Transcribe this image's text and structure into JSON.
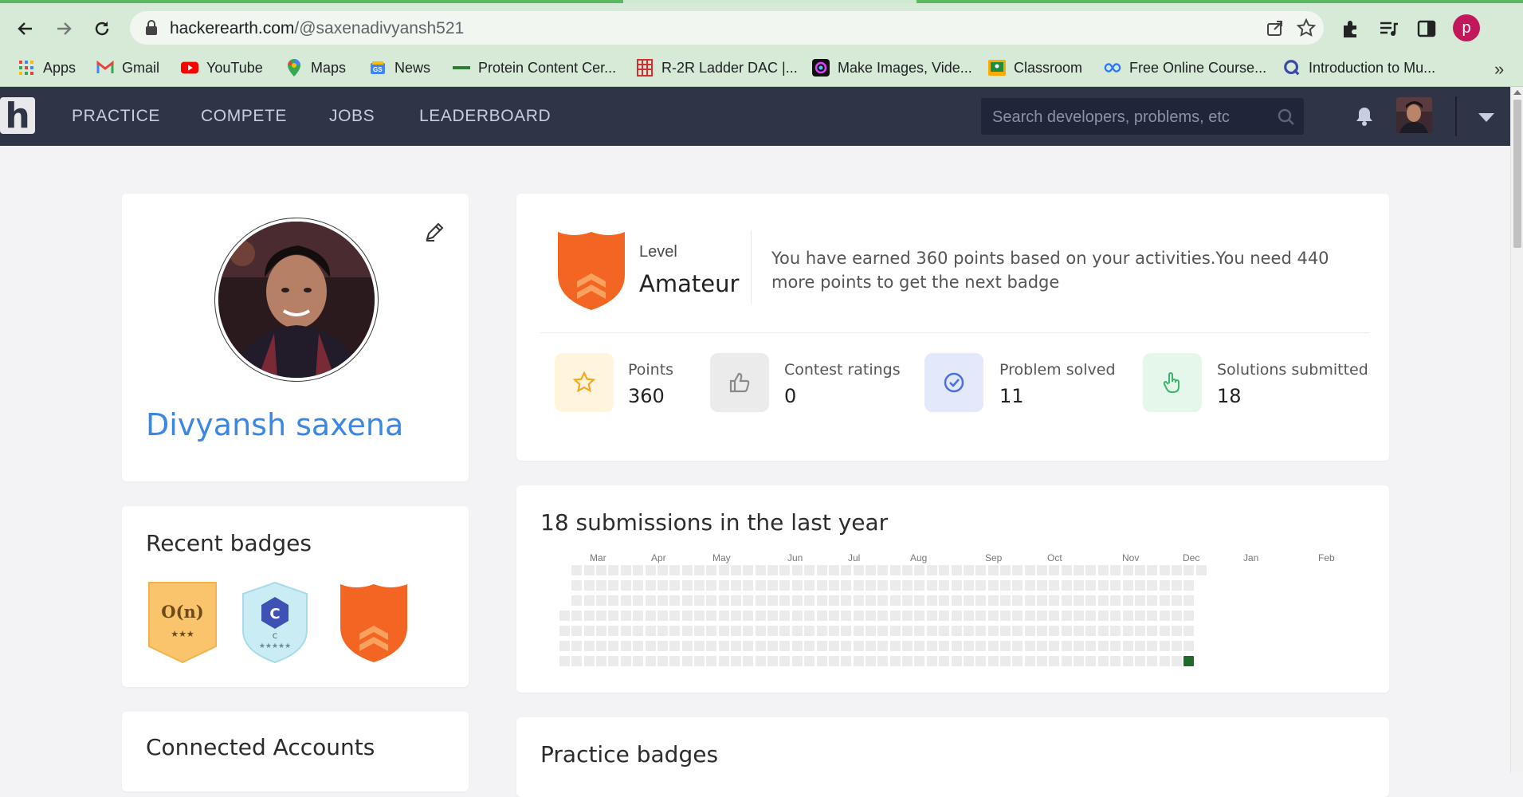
{
  "browser": {
    "url_host": "hackerearth.com",
    "url_path": "/@saxenadivyansh521",
    "profile_initial": "p",
    "bookmarks": [
      {
        "label": "Apps",
        "icon": "apps-grid-icon"
      },
      {
        "label": "Gmail",
        "icon": "gmail-icon"
      },
      {
        "label": "YouTube",
        "icon": "youtube-icon"
      },
      {
        "label": "Maps",
        "icon": "maps-icon"
      },
      {
        "label": "News",
        "icon": "news-icon"
      },
      {
        "label": "Protein Content Cer...",
        "icon": "protein-icon"
      },
      {
        "label": "R-2R Ladder DAC |...",
        "icon": "circuit-icon"
      },
      {
        "label": "Make Images, Vide...",
        "icon": "canva-icon"
      },
      {
        "label": "Classroom",
        "icon": "classroom-icon"
      },
      {
        "label": "Free Online Course...",
        "icon": "course-icon"
      },
      {
        "label": "Introduction to Mu...",
        "icon": "q-icon"
      }
    ],
    "more": "»"
  },
  "site": {
    "logo": "h",
    "nav": [
      "PRACTICE",
      "COMPETE",
      "JOBS",
      "LEADERBOARD"
    ],
    "search_placeholder": "Search developers, problems, etc"
  },
  "profile": {
    "name": "Divyansh saxena"
  },
  "recent_badges": {
    "title": "Recent badges",
    "badges": [
      {
        "name": "complexity-badge",
        "text": "O(n)",
        "stars": "★★★",
        "color": "#f9c46b"
      },
      {
        "name": "c-language-badge",
        "text": "C",
        "sub": "C",
        "stars": "★★★★★",
        "color": "#c9ecf5"
      },
      {
        "name": "amateur-badge",
        "color": "#f26522"
      }
    ]
  },
  "connected_accounts": {
    "title": "Connected Accounts"
  },
  "level": {
    "label": "Level",
    "value": "Amateur",
    "description": "You have earned 360 points based on your activities.You need 440 more points to get the next badge"
  },
  "stats": [
    {
      "label": "Points",
      "value": "360",
      "icon": "star-icon",
      "bg": "#fff5dc",
      "fg": "#f4a81d"
    },
    {
      "label": "Contest ratings",
      "value": "0",
      "icon": "thumbs-up-icon",
      "bg": "#ebebeb",
      "fg": "#8a8a8a"
    },
    {
      "label": "Problem solved",
      "value": "11",
      "icon": "check-circle-icon",
      "bg": "#e3e9fb",
      "fg": "#4a6fe3"
    },
    {
      "label": "Solutions submitted",
      "value": "18",
      "icon": "pointer-hand-icon",
      "bg": "#e5f6ea",
      "fg": "#3bb56b"
    }
  ],
  "activity": {
    "title": "18 submissions in the last year",
    "months": [
      "Mar",
      "Apr",
      "May",
      "Jun",
      "Jul",
      "Aug",
      "Sep",
      "Oct",
      "Nov",
      "Dec",
      "Jan",
      "Feb"
    ],
    "active_color": "#1f6b2c",
    "empty_color": "#ebebeb"
  },
  "practice_badges": {
    "title": "Practice badges"
  }
}
